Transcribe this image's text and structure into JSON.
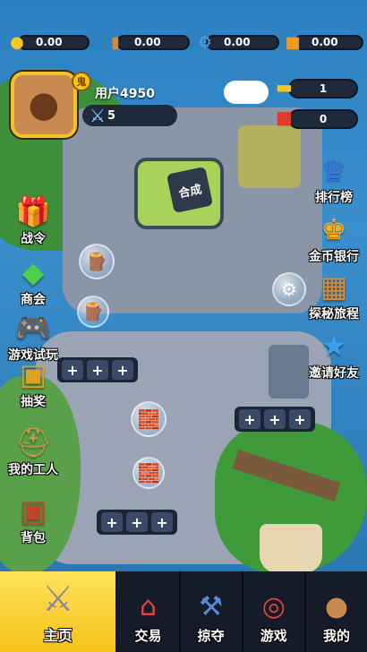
{
  "resources": [
    {
      "name": "gold",
      "icon": "gold-coins-icon",
      "value": "0.00"
    },
    {
      "name": "wood",
      "icon": "wood-log-icon",
      "value": "0.00"
    },
    {
      "name": "gear",
      "icon": "gear-icon",
      "value": "0.00"
    },
    {
      "name": "block",
      "icon": "orange-block-icon",
      "value": "0.00"
    }
  ],
  "profile": {
    "avatar_icon": "capybara-avatar-icon",
    "badge": "鬼",
    "username": "用户4950",
    "power_icon": "sword-icon",
    "power": "5"
  },
  "right_counters": [
    {
      "icon": "ticket-icon",
      "value": "1"
    },
    {
      "icon": "red-bag-icon",
      "value": "0"
    }
  ],
  "left_menu": [
    {
      "label": "战令",
      "icon": "gift-box-icon"
    },
    {
      "label": "商会",
      "icon": "green-crystal-icon"
    },
    {
      "label": "游戏试玩",
      "icon": "gamepad-icon"
    },
    {
      "label": "抽奖",
      "icon": "treasure-chest-icon"
    },
    {
      "label": "我的工人",
      "icon": "worker-helmet-icon"
    },
    {
      "label": "背包",
      "icon": "backpack-icon"
    }
  ],
  "right_menu": [
    {
      "label": "排行榜",
      "icon": "leaderboard-icon"
    },
    {
      "label": "金币银行",
      "icon": "crown-bank-icon"
    },
    {
      "label": "探秘旅程",
      "icon": "map-screen-icon"
    },
    {
      "label": "邀请好友",
      "icon": "star-invite-icon"
    }
  ],
  "machine_label": "合成",
  "slot_symbol": "+",
  "nav": [
    {
      "label": "主页",
      "icon": "crossed-swords-icon",
      "active": true
    },
    {
      "label": "交易",
      "icon": "market-stall-icon",
      "active": false
    },
    {
      "label": "掠夺",
      "icon": "axe-icon",
      "active": false
    },
    {
      "label": "游戏",
      "icon": "target-icon",
      "active": false
    },
    {
      "label": "我的",
      "icon": "capybara-face-icon",
      "active": false
    }
  ],
  "colors": {
    "nav_active": "#f6c21a",
    "nav_bg": "#151b28",
    "pill_bg": "#1e2a3c",
    "avatar_border": "#f3c22b"
  }
}
